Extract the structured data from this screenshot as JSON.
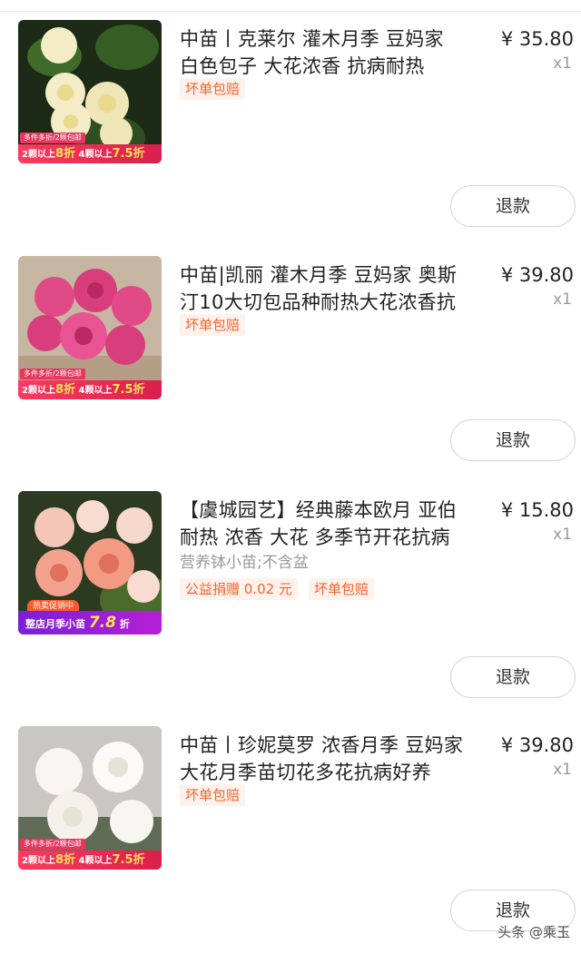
{
  "orders": [
    {
      "title_line1": "中苗丨克莱尔 灌木月季 豆妈家",
      "title_line2": "白色包子 大花浓香 抗病耐热",
      "price": "¥ 35.80",
      "qty": "x1",
      "tags": [
        "坏单包赔"
      ],
      "promo_top": "多件多折/2颗包邮",
      "promo_bottom_a": "2颗以上",
      "promo_bottom_a_val": "8折",
      "promo_bottom_b": "4颗以上",
      "promo_bottom_b_val": "7.5折",
      "refund_label": "退款",
      "flower_color": "#f3ecc6"
    },
    {
      "title_line1": "中苗|凯丽 灌木月季 豆妈家 奥斯",
      "title_line2": "汀10大切包品种耐热大花浓香抗",
      "price": "¥ 39.80",
      "qty": "x1",
      "tags": [
        "坏单包赔"
      ],
      "promo_top": "多件多折/2颗包邮",
      "promo_bottom_a": "2颗以上",
      "promo_bottom_a_val": "8折",
      "promo_bottom_b": "4颗以上",
      "promo_bottom_b_val": "7.5折",
      "refund_label": "退款",
      "flower_color": "#e04a86"
    },
    {
      "title_line1": "【虞城园艺】经典藤本欧月 亚伯",
      "title_line2": "耐热 浓香 大花 多季节开花抗病",
      "spec": "营养钵小苗;不含盆",
      "price": "¥ 15.80",
      "qty": "x1",
      "tags": [
        "公益捐赠 0.02 元",
        "坏单包赔"
      ],
      "hot_tag": "热卖促销中",
      "promo_purple": "整店月季小苗",
      "promo_purple_val": "7.8",
      "promo_purple_suffix": "折",
      "refund_label": "退款",
      "flower_color": "#f3a38d"
    },
    {
      "title_line1": "中苗丨珍妮莫罗 浓香月季 豆妈家",
      "title_line2": "大花月季苗切花多花抗病好养",
      "price": "¥ 39.80",
      "qty": "x1",
      "tags": [
        "坏单包赔"
      ],
      "promo_top": "多件多折/2颗包邮",
      "promo_bottom_a": "2颗以上",
      "promo_bottom_a_val": "8折",
      "promo_bottom_b": "4颗以上",
      "promo_bottom_b_val": "7.5折",
      "refund_label": "退款",
      "flower_color": "#f7f5f0"
    }
  ],
  "watermark": "头条 @乘玉"
}
